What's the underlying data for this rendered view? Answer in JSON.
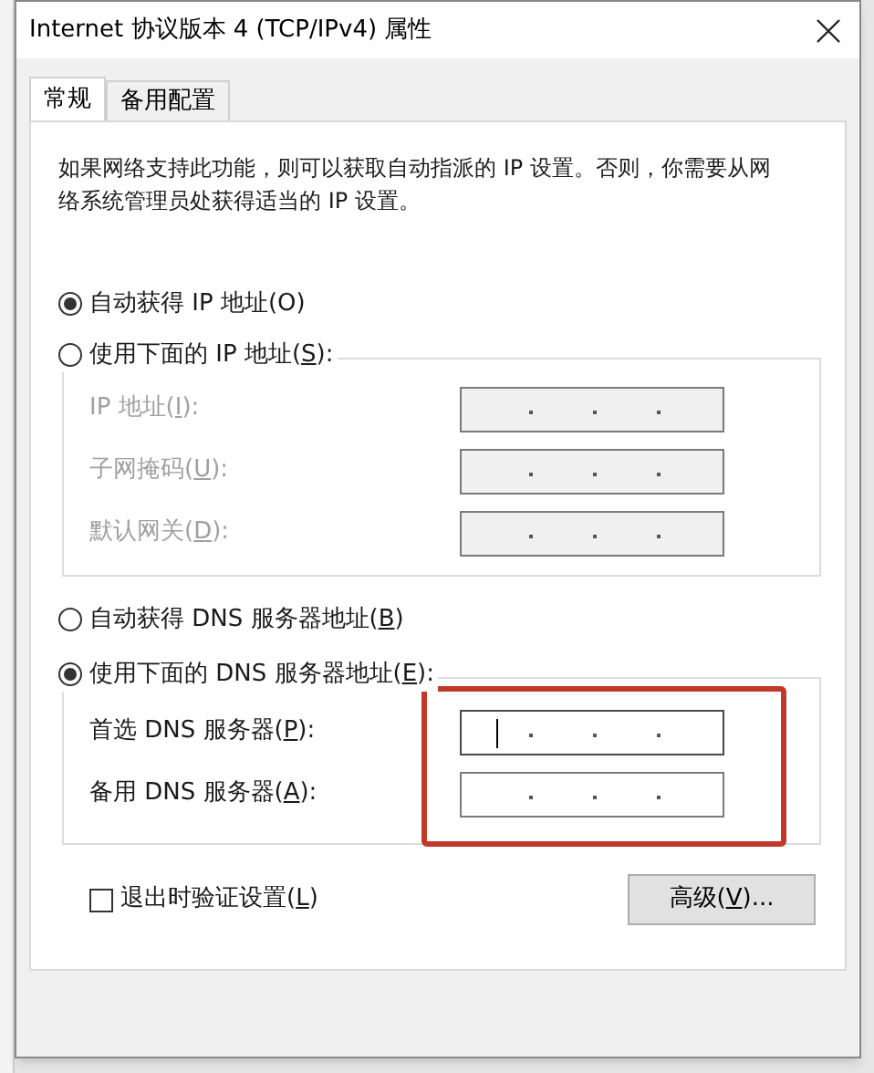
{
  "window": {
    "title": "Internet 协议版本 4 (TCP/IPv4) 属性"
  },
  "tabs": [
    {
      "label": "常规",
      "selected": true
    },
    {
      "label": "备用配置",
      "selected": false
    }
  ],
  "description": "如果网络支持此功能，则可以获取自动指派的 IP 设置。否则，你需要从网络系统管理员处获得适当的 IP 设置。",
  "ip_mode": [
    {
      "label_parts": [
        "自动获得 IP 地址(O)"
      ],
      "selected": true
    },
    {
      "label_parts": [
        "使用下面的 IP 地址(",
        "S",
        "):"
      ],
      "selected": false
    }
  ],
  "ip_fields": [
    {
      "label_parts": [
        "IP 地址(",
        "I",
        "):"
      ],
      "disabled": true,
      "focused": false
    },
    {
      "label_parts": [
        "子网掩码(",
        "U",
        "):"
      ],
      "disabled": true,
      "focused": false
    },
    {
      "label_parts": [
        "默认网关(",
        "D",
        "):"
      ],
      "disabled": true,
      "focused": false
    }
  ],
  "dns_mode": [
    {
      "label_parts": [
        "自动获得 DNS 服务器地址(",
        "B",
        ")"
      ],
      "selected": false
    },
    {
      "label_parts": [
        "使用下面的 DNS 服务器地址(",
        "E",
        "):"
      ],
      "selected": true
    }
  ],
  "dns_fields": [
    {
      "label_parts": [
        "首选 DNS 服务器(",
        "P",
        "):"
      ],
      "disabled": false,
      "focused": true
    },
    {
      "label_parts": [
        "备用 DNS 服务器(",
        "A",
        "):"
      ],
      "disabled": false,
      "focused": false
    }
  ],
  "highlight": true,
  "validate_on_exit": {
    "label_parts": [
      "退出时验证设置(",
      "L",
      ")"
    ],
    "checked": false
  },
  "advanced_button": {
    "label_parts": [
      "高级(",
      "V",
      ")..."
    ]
  }
}
